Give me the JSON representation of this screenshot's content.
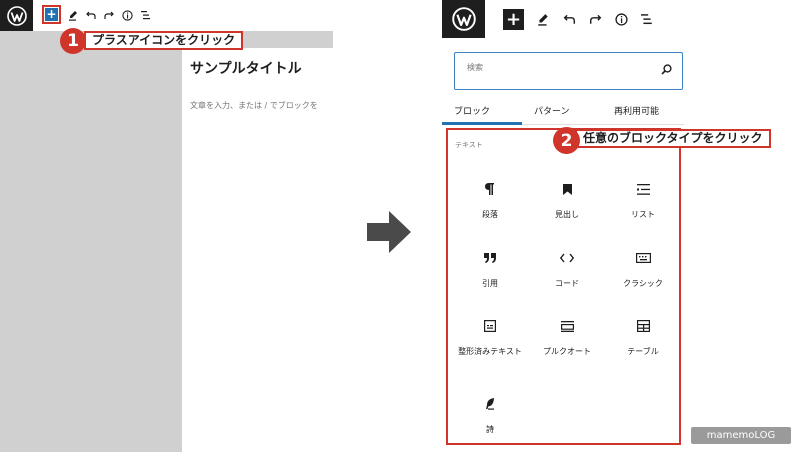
{
  "left": {
    "callout_number": "1",
    "callout_text": "プラスアイコンをクリック",
    "post_title": "サンプルタイトル",
    "post_placeholder": "文章を入力、または / でブロックを",
    "inserter_icon": "plus-icon",
    "toolbar_icons": [
      "pencil-icon",
      "undo-icon",
      "redo-icon",
      "info-icon",
      "list-view-icon"
    ]
  },
  "right": {
    "callout_number": "2",
    "callout_text": "任意のブロックタイプをクリック",
    "search_placeholder": "検索",
    "tabs": [
      "ブロック",
      "パターン",
      "再利用可能"
    ],
    "active_tab": "ブロック",
    "category": "テキスト",
    "blocks": [
      {
        "label": "段落",
        "icon": "paragraph-icon"
      },
      {
        "label": "見出し",
        "icon": "heading-icon"
      },
      {
        "label": "リスト",
        "icon": "list-icon"
      },
      {
        "label": "引用",
        "icon": "quote-icon"
      },
      {
        "label": "コード",
        "icon": "code-icon"
      },
      {
        "label": "クラシック",
        "icon": "classic-icon"
      },
      {
        "label": "整形済みテキスト",
        "icon": "preformatted-icon"
      },
      {
        "label": "プルクオート",
        "icon": "pullquote-icon"
      },
      {
        "label": "テーブル",
        "icon": "table-icon"
      },
      {
        "label": "詩",
        "icon": "verse-icon"
      }
    ],
    "watermark": "mamemoLOG"
  },
  "colors": {
    "accent_red": "#d0352b",
    "wp_dark": "#1e1e1e",
    "wp_blue": "#2271b1",
    "gray_canvas": "#d0d0d0"
  }
}
